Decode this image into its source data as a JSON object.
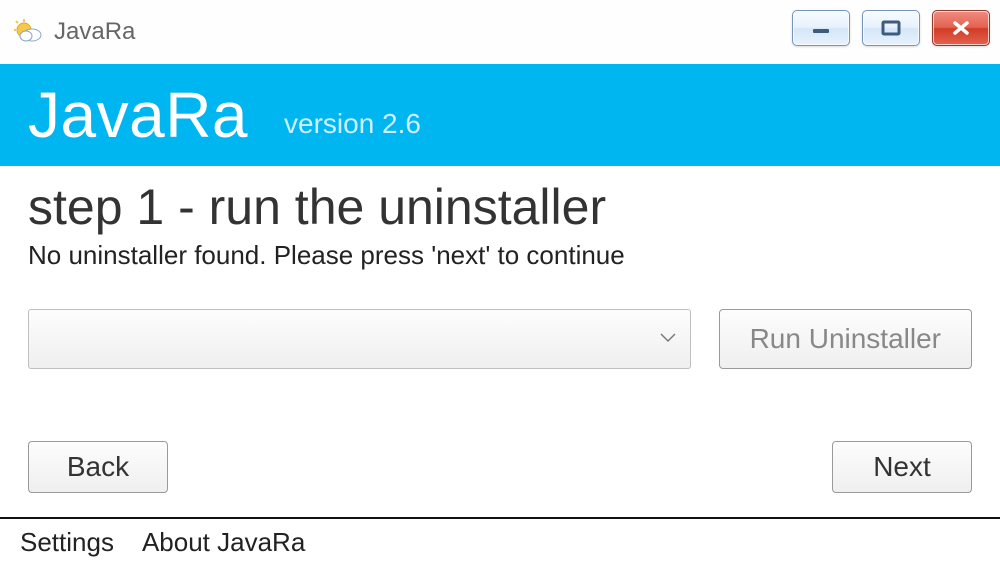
{
  "titlebar": {
    "app_name": "JavaRa",
    "icons": {
      "app": "sun-cloud-icon",
      "minimize": "minimize-icon",
      "maximize": "maximize-icon",
      "close": "close-icon"
    }
  },
  "header": {
    "brand": "JavaRa",
    "version": "version 2.6"
  },
  "main": {
    "step_title": "step 1 - run the uninstaller",
    "message": "No uninstaller found. Please press 'next' to continue",
    "dropdown_value": "",
    "run_uninstaller_label": "Run Uninstaller",
    "back_label": "Back",
    "next_label": "Next"
  },
  "footer": {
    "settings_label": "Settings",
    "about_label": "About JavaRa"
  },
  "colors": {
    "accent": "#00b6f0",
    "close_red": "#d13c27"
  }
}
